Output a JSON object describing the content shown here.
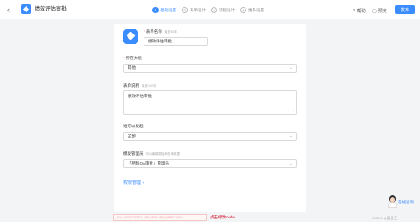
{
  "header": {
    "back_glyph": "‹",
    "app_icon": "approval-app-icon",
    "title": "绩效评估审批",
    "edit_glyph": "✎",
    "steps": [
      {
        "num": "1",
        "label": "基础设置",
        "active": true
      },
      {
        "num": "2",
        "label": "表单设计",
        "active": false
      },
      {
        "num": "3",
        "label": "流程设计",
        "active": false
      },
      {
        "num": "4",
        "label": "更多设置",
        "active": false
      }
    ],
    "help_label": "帮助",
    "preview_label": "预览",
    "save_label": "发布"
  },
  "form": {
    "form_icon": "approval-form-icon",
    "name": {
      "label": "表单名称",
      "hint": "最多50字",
      "value": "绩效评估审批"
    },
    "group": {
      "label": "所在分组",
      "value": "其他",
      "caret": "⌄"
    },
    "description": {
      "label": "表单说明",
      "hint": "最多100字",
      "value": "绩效评估审批",
      "grip": "⟋"
    },
    "submitter": {
      "label": "谁可以发起",
      "value": "全部",
      "caret": "⌄"
    },
    "manager": {
      "label": "模板管理员",
      "hint": "可以编辑模板和查询数据",
      "value": "「所有OA审批」管理员",
      "caret": "⌄"
    },
    "advanced_link": "权限管理 ›"
  },
  "footer": {
    "blurred_text": "IOA-VSZ3Z11ZEX-M82-4829-5PAQ8PPAXU5X",
    "red_text": "点击修改code"
  },
  "assistant": {
    "label": "在线咨询"
  },
  "watermark": "CSDN @蛋蛋王"
}
